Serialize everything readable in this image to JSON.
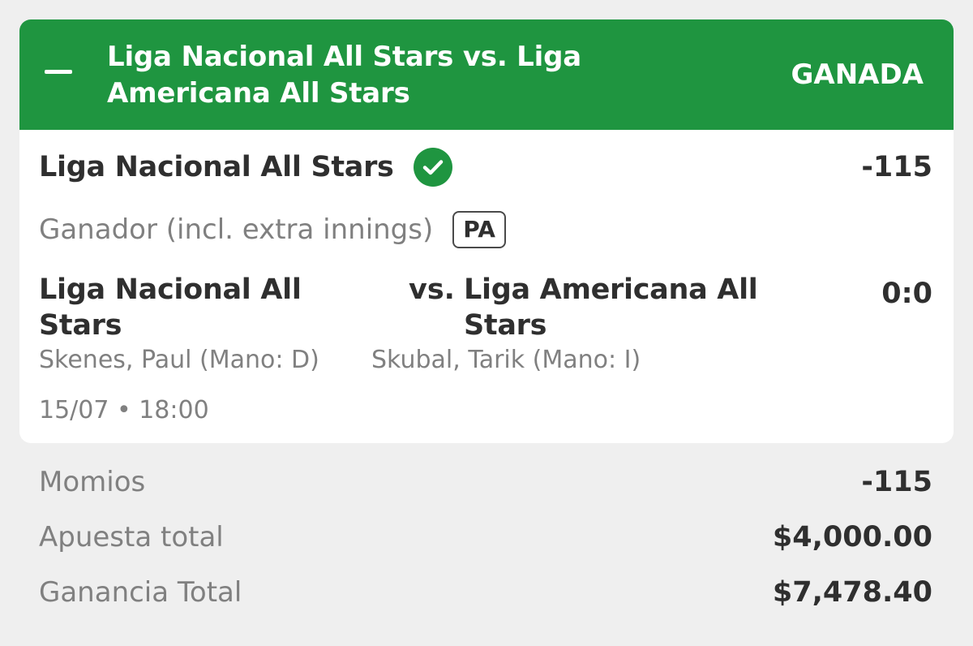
{
  "header": {
    "title": "Liga Nacional All Stars vs. Liga Americana All Stars",
    "status": "GANADA",
    "accent_color": "#1f9540",
    "collapse_icon": "minus-icon"
  },
  "selection": {
    "name": "Liga Nacional All Stars",
    "odds": "-115",
    "result_icon": "check-circle-icon",
    "market": "Ganador (incl. extra innings)",
    "badge": "PA"
  },
  "event": {
    "home_team": "Liga Nacional All Stars",
    "vs": "vs.",
    "away_team": "Liga Americana All Stars",
    "score": "0:0",
    "home_pitcher": "Skenes, Paul (Mano: D)",
    "away_pitcher": "Skubal, Tarik (Mano: I)",
    "datetime": "15/07 • 18:00"
  },
  "summary": [
    {
      "label": "Momios",
      "value": "-115"
    },
    {
      "label": "Apuesta total",
      "value": "$4,000.00"
    },
    {
      "label": "Ganancia Total",
      "value": "$7,478.40"
    }
  ]
}
